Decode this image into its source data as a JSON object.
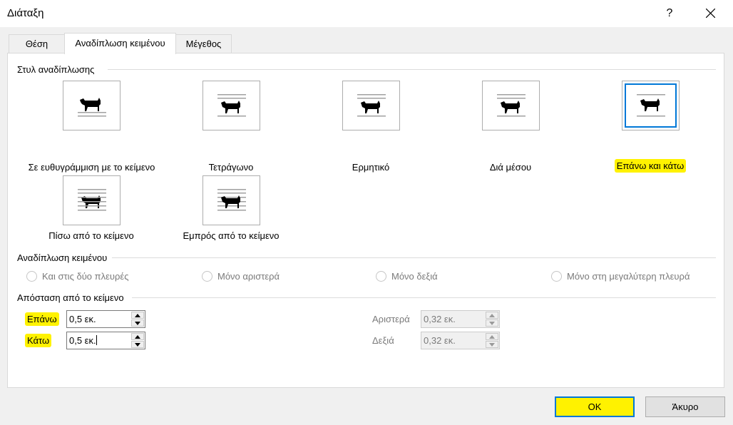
{
  "window": {
    "title": "Διάταξη",
    "help": "?"
  },
  "tabs": [
    "Θέση",
    "Αναδίπλωση κειμένου",
    "Μέγεθος"
  ],
  "wrap_style": {
    "section_label": "Στυλ αναδίπλωσης",
    "options": [
      {
        "label": "Σε ευθυγράμμιση με το κείμενο",
        "icon": "inline-dog-icon"
      },
      {
        "label": "Τετράγωνο",
        "icon": "square-wrap-dog-icon"
      },
      {
        "label": "Ερμητικό",
        "icon": "tight-wrap-dog-icon"
      },
      {
        "label": "Διά μέσου",
        "icon": "through-wrap-dog-icon"
      },
      {
        "label": "Επάνω και κάτω",
        "icon": "top-bottom-dog-icon",
        "selected": true
      },
      {
        "label": "Πίσω από το κείμενο",
        "icon": "behind-text-dog-icon"
      },
      {
        "label": "Εμπρός από το κείμενο",
        "icon": "in-front-dog-icon"
      }
    ]
  },
  "wrap_text": {
    "section_label": "Αναδίπλωση κειμένου",
    "options": [
      "Και στις δύο πλευρές",
      "Μόνο αριστερά",
      "Μόνο δεξιά",
      "Μόνο στη μεγαλύτερη πλευρά"
    ]
  },
  "distance": {
    "section_label": "Απόσταση από το κείμενο",
    "top_label": "Επάνω",
    "top_value": "0,5 εκ.",
    "bottom_label": "Κάτω",
    "bottom_value": "0,5 εκ.",
    "left_label": "Αριστερά",
    "left_value": "0,32 εκ.",
    "right_label": "Δεξιά",
    "right_value": "0,32 εκ."
  },
  "buttons": {
    "ok": "OK",
    "cancel": "Άκυρο"
  },
  "colors": {
    "highlight": "#fff200",
    "accent": "#0078d7"
  }
}
